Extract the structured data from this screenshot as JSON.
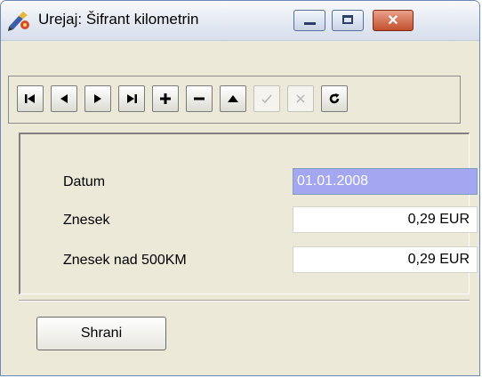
{
  "window": {
    "title": "Urejaj: Šifrant kilometrin",
    "app_icon": "pen-paint-app-icon",
    "controls": [
      "minimize-icon",
      "maximize-icon",
      "close-icon"
    ],
    "close_glyph": "✕"
  },
  "navigator": {
    "buttons": [
      {
        "name": "first-record-button",
        "icon": "first-icon",
        "enabled": true
      },
      {
        "name": "prior-record-button",
        "icon": "prior-icon",
        "enabled": true
      },
      {
        "name": "next-record-button",
        "icon": "next-icon",
        "enabled": true
      },
      {
        "name": "last-record-button",
        "icon": "last-icon",
        "enabled": true
      },
      {
        "name": "insert-record-button",
        "icon": "plus-icon",
        "enabled": true
      },
      {
        "name": "delete-record-button",
        "icon": "minus-icon",
        "enabled": true
      },
      {
        "name": "edit-record-button",
        "icon": "up-triangle-icon",
        "enabled": true
      },
      {
        "name": "post-record-button",
        "icon": "check-icon",
        "enabled": false
      },
      {
        "name": "cancel-record-button",
        "icon": "cancel-x-icon",
        "enabled": false
      },
      {
        "name": "refresh-record-button",
        "icon": "refresh-icon",
        "enabled": true
      }
    ]
  },
  "form": {
    "datum": {
      "label": "Datum",
      "value": "01.01.2008"
    },
    "znesek": {
      "label": "Znesek",
      "value": "0,29 EUR"
    },
    "znesek_nad": {
      "label": "Znesek nad 500KM",
      "value": "0,29 EUR"
    }
  },
  "footer": {
    "save_label": "Shrani"
  },
  "colors": {
    "selection": "#a3a6f1",
    "window_bg": "#ece9d8",
    "close_button": "#c2502f"
  }
}
